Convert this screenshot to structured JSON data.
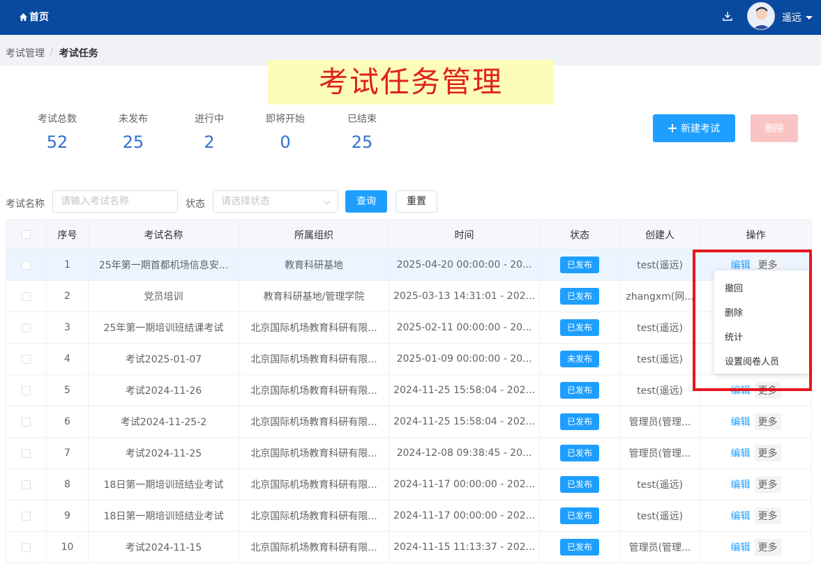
{
  "header": {
    "home_label": "首页",
    "user_name": "遥远"
  },
  "breadcrumb": {
    "parent": "考试管理",
    "separator": "/",
    "current": "考试任务"
  },
  "page_title": "考试任务管理",
  "stats": [
    {
      "label": "考试总数",
      "value": "52"
    },
    {
      "label": "未发布",
      "value": "25"
    },
    {
      "label": "进行中",
      "value": "2"
    },
    {
      "label": "即将开始",
      "value": "0"
    },
    {
      "label": "已结束",
      "value": "25"
    }
  ],
  "toolbar": {
    "new_label": "新建考试",
    "delete_label": "删除"
  },
  "search": {
    "name_label": "考试名称",
    "name_placeholder": "请输入考试名称",
    "status_label": "状态",
    "status_placeholder": "请选择状态",
    "query_label": "查询",
    "reset_label": "重置"
  },
  "table": {
    "columns": [
      "序号",
      "考试名称",
      "所属组织",
      "时间",
      "状态",
      "创建人",
      "操作"
    ],
    "edit_label": "编辑",
    "more_label": "更多",
    "rows": [
      {
        "no": "1",
        "name": "25年第一期首都机场信息安...",
        "org": "教育科研基地",
        "time": "2025-04-20 00:00:00 - 20...",
        "status": "已发布",
        "creator": "test(遥远)"
      },
      {
        "no": "2",
        "name": "党员培训",
        "org": "教育科研基地/管理学院",
        "time": "2025-03-13 14:31:01 - 202...",
        "status": "已发布",
        "creator": "zhangxm(网..."
      },
      {
        "no": "3",
        "name": "25年第一期培训班结课考试",
        "org": "北京国际机场教育科研有限...",
        "time": "2025-02-11 00:00:00 - 20...",
        "status": "已发布",
        "creator": "test(遥远)"
      },
      {
        "no": "4",
        "name": "考试2025-01-07",
        "org": "北京国际机场教育科研有限...",
        "time": "2025-01-09 00:00:00 - 20...",
        "status": "未发布",
        "creator": "test(遥远)"
      },
      {
        "no": "5",
        "name": "考试2024-11-26",
        "org": "北京国际机场教育科研有限...",
        "time": "2024-11-25 15:58:04 - 202...",
        "status": "已发布",
        "creator": "test(遥远)"
      },
      {
        "no": "6",
        "name": "考试2024-11-25-2",
        "org": "北京国际机场教育科研有限...",
        "time": "2024-11-25 15:58:04 - 202...",
        "status": "已发布",
        "creator": "管理员(管理..."
      },
      {
        "no": "7",
        "name": "考试2024-11-25",
        "org": "北京国际机场教育科研有限...",
        "time": "2024-12-08 09:38:45 - 20...",
        "status": "已发布",
        "creator": "管理员(管理..."
      },
      {
        "no": "8",
        "name": "18日第一期培训班结业考试",
        "org": "北京国际机场教育科研有限...",
        "time": "2024-11-17 00:00:00 - 202...",
        "status": "已发布",
        "creator": "test(遥远)"
      },
      {
        "no": "9",
        "name": "18日第一期培训班结业考试",
        "org": "北京国际机场教育科研有限...",
        "time": "2024-11-17 00:00:00 - 202...",
        "status": "已发布",
        "creator": "test(遥远)"
      },
      {
        "no": "10",
        "name": "考试2024-11-15",
        "org": "北京国际机场教育科研有限...",
        "time": "2024-11-15 11:13:37 - 202...",
        "status": "已发布",
        "creator": "管理员(管理..."
      }
    ]
  },
  "more_menu": {
    "items": [
      "撤回",
      "删除",
      "统计",
      "设置阅卷人员"
    ]
  },
  "colors": {
    "header_bg": "#0a4a9e",
    "primary": "#1e9fff",
    "title_text": "#e02020",
    "title_bg": "#fdfdb8",
    "highlight_box": "#e8141b"
  }
}
